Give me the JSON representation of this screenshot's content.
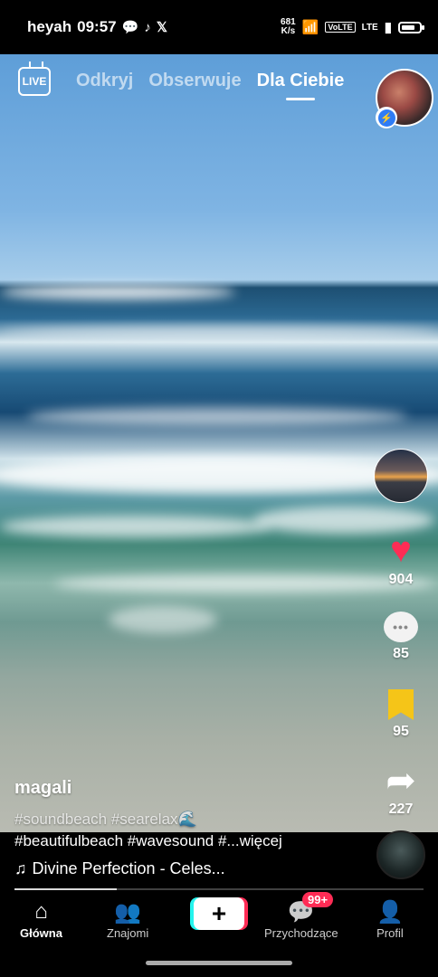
{
  "status_bar": {
    "carrier": "heyah",
    "time": "09:57",
    "net_speed_value": "681",
    "net_speed_unit": "K/s",
    "volte": "VoLTE",
    "lte": "LTE",
    "battery_level": 0.75
  },
  "top_nav": {
    "live_label": "LIVE",
    "tabs": [
      {
        "label": "Odkryj"
      },
      {
        "label": "Obserwuje"
      },
      {
        "label": "Dla Ciebie"
      }
    ]
  },
  "video": {
    "username": "magali",
    "hashtags_line1": "#soundbeach #searelax🌊",
    "hashtags_line2": "#beautifulbeach #wavesound #",
    "more_label": "...więcej",
    "music": "Divine Perfection - Celes...",
    "progress": 0.25
  },
  "actions": {
    "likes": "904",
    "comments": "85",
    "saves": "95",
    "shares": "227"
  },
  "bottom_nav": {
    "items": [
      {
        "label": "Główna"
      },
      {
        "label": "Znajomi"
      },
      {
        "label": "Przychodzące"
      },
      {
        "label": "Profil"
      }
    ],
    "create_label": "+",
    "inbox_badge": "99+"
  },
  "colors": {
    "accent": "#fe2c55",
    "bookmark": "#f5c518",
    "secondary_accent": "#25f4ee"
  },
  "icons": [
    "message-icon",
    "tiktok-icon",
    "x-icon",
    "wifi-icon",
    "signal-icon",
    "battery-icon",
    "live-icon",
    "messenger-icon",
    "heart-icon",
    "comment-icon",
    "bookmark-icon",
    "share-icon",
    "music-note-icon",
    "home-icon",
    "friends-icon",
    "inbox-icon",
    "profile-icon"
  ]
}
